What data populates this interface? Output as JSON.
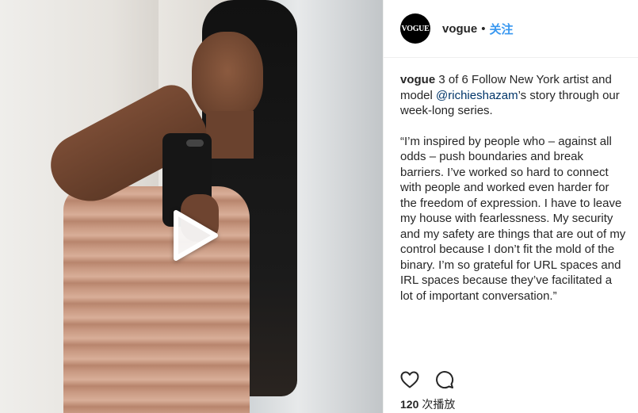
{
  "post": {
    "account": {
      "username": "vogue",
      "avatar_text": "VOGUE",
      "separator": "•",
      "follow_label": "关注"
    },
    "caption": {
      "username": "vogue",
      "intro_after_username": " 3 of 6 Follow New York artist and model ",
      "mention": "@richieshazam",
      "intro_end": "’s story through our week-long series.",
      "quote": "“I’m inspired by people who – against all odds – push boundaries and break barriers. I’ve worked so hard to connect with people and worked even harder for the freedom of expression. I have to leave my house with fearlessness. My security and my safety are things that are out of my control because I don’t fit the mold of the binary. I’m so grateful for URL spaces and IRL spaces because they’ve facilitated a lot of important conversation.”"
    },
    "actions": {
      "like_icon": "heart-icon",
      "comment_icon": "comment-icon"
    },
    "views": {
      "count": "120",
      "label": "次播放"
    },
    "media": {
      "play_icon": "play-icon"
    }
  }
}
